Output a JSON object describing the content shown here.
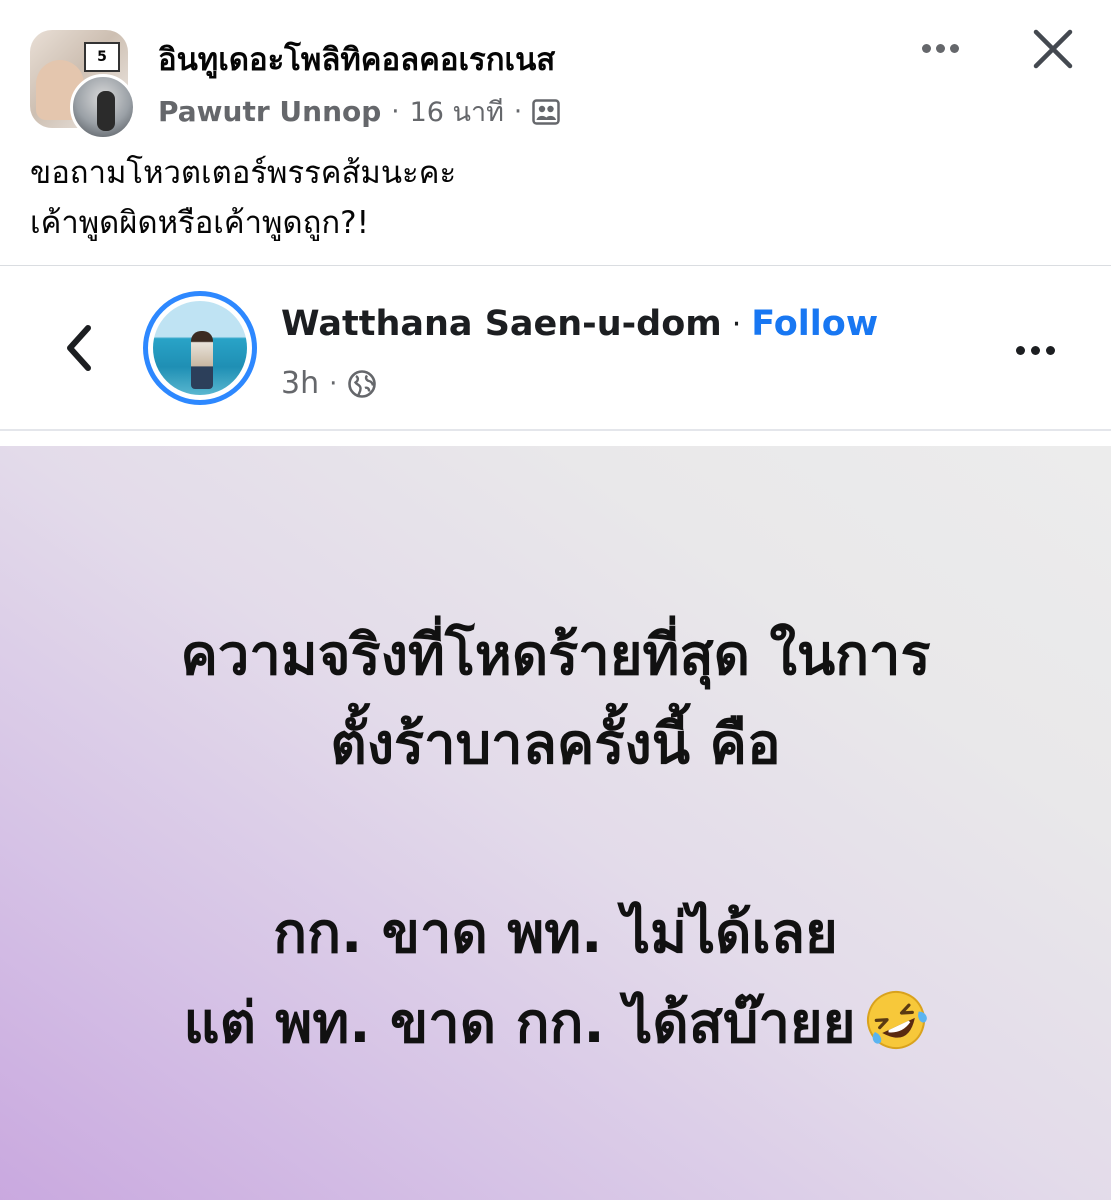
{
  "post": {
    "group_name": "อินทูเดอะโพลิทิคอลคอเรกเนส",
    "author": "Pawutr Unnop",
    "separator": "·",
    "time": "16 นาที",
    "caption_lines": [
      "ขอถามโหวตเตอร์พรรคส้มนะคะ",
      "เค้าพูดผิดหรือเค้าพูดถูก?!"
    ],
    "icons": {
      "more": "more-horizontal-icon",
      "close": "close-icon",
      "audience": "group-audience-icon"
    },
    "avatar_tag_text": "5"
  },
  "embedded_post": {
    "name": "Watthana Saen-u-dom",
    "separator": "·",
    "follow_label": "Follow",
    "time": "3h",
    "icons": {
      "back": "chevron-left-icon",
      "privacy": "globe-icon",
      "more": "more-horizontal-icon"
    },
    "status_lines": [
      "ความจริงที่โหดร้ายที่สุด ในการ",
      "ตั้งร้าบาลครั้งนี้ คือ",
      "กก. ขาด พท. ไม่ได้เลย",
      "แต่ พท. ขาด กก. ได้สบ๊ายย"
    ],
    "emoji": "rolling-on-floor-laughing"
  },
  "colors": {
    "link_blue": "#1877f2",
    "secondary_text": "#65676b",
    "story_ring": "#2d88ff",
    "card_gradient_start": "#c9a8df",
    "card_gradient_end": "#ececec"
  }
}
